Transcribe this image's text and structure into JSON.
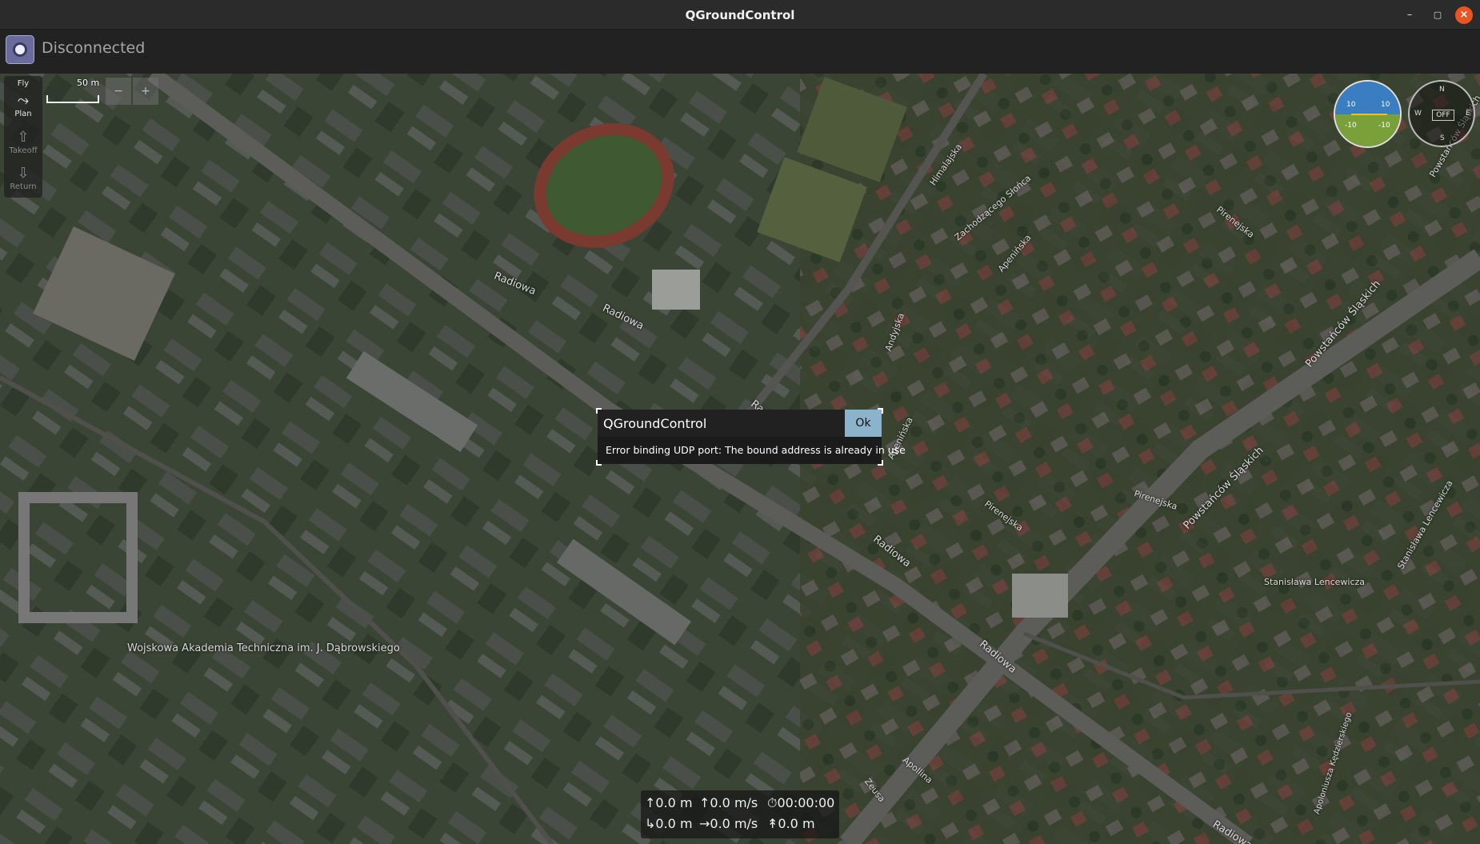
{
  "window": {
    "title": "QGroundControl",
    "minimize_glyph": "–",
    "maximize_glyph": "▢",
    "close_glyph": "×"
  },
  "toolbar": {
    "connection_status": "Disconnected",
    "logo_icon": "qgc-logo-icon"
  },
  "left_tools": [
    {
      "label": "Fly",
      "icon": "paper-plane-icon",
      "enabled": true
    },
    {
      "label": "Plan",
      "icon": "waypoint-path-icon",
      "glyph": "⤳",
      "enabled": true
    },
    {
      "label": "Takeoff",
      "icon": "takeoff-icon",
      "glyph": "⇧",
      "enabled": false
    },
    {
      "label": "Return",
      "icon": "return-icon",
      "glyph": "⇩",
      "enabled": false
    }
  ],
  "map": {
    "scale_label": "50 m",
    "street_labels": [
      "Radiowa",
      "Radiowa",
      "Radiowa",
      "Radiowa",
      "Radiowa",
      "Radiowa",
      "Himalajska",
      "Zachodzącego Słońca",
      "Apenińska",
      "Andyjska",
      "Pirenejska",
      "Pirenejska",
      "Pirenejska",
      "Apenińska",
      "Powstańców Śląskich",
      "Powstańców Śląskich",
      "Powstańców Śląskich",
      "Stanisława Lencewicza",
      "Stanisława Lencewicza",
      "Apoloniusza Kędzierskiego",
      "Apollina",
      "Zeusa",
      "Wojskowa Akademia Techniczna im. J. Dąbrowskiego"
    ]
  },
  "instruments": {
    "attitude": {
      "pitch_up": "10",
      "pitch_down": "-10"
    },
    "compass": {
      "north": "N",
      "south": "S",
      "east": "E",
      "west": "W",
      "heading_readout": "OFF"
    }
  },
  "dialog": {
    "title": "QGroundControl",
    "ok_label": "Ok",
    "message": "Error binding UDP port: The bound address is already in use"
  },
  "telemetry": {
    "altitude": "0.0 m",
    "climb_rate": "0.0 m/s",
    "flight_time": "00:00:00",
    "distance": "0.0 m",
    "ground_speed": "0.0 m/s",
    "home_distance": "0.0 m"
  },
  "colors": {
    "accent": "#8cb3cc",
    "close_button": "#e95420",
    "status_text": "#a6a6a6"
  }
}
